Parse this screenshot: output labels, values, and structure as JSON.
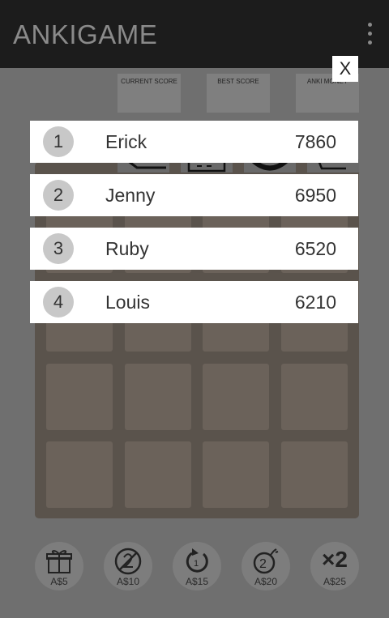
{
  "app": {
    "title": "ANKIGAME"
  },
  "scores": [
    {
      "label": "CURRENT SCORE"
    },
    {
      "label": "BEST SCORE"
    },
    {
      "label": "ANKI MONEY"
    }
  ],
  "overlay": {
    "close_label": "X"
  },
  "leaderboard": [
    {
      "rank": "1",
      "name": "Erick",
      "score": "7860"
    },
    {
      "rank": "2",
      "name": "Jenny",
      "score": "6950"
    },
    {
      "rank": "3",
      "name": "Ruby",
      "score": "6520"
    },
    {
      "rank": "4",
      "name": "Louis",
      "score": "6210"
    }
  ],
  "board": {
    "rows": 4,
    "cols": 4
  },
  "powerups": [
    {
      "icon": "gift-icon",
      "price": "A$5"
    },
    {
      "icon": "no-two-icon",
      "price": "A$10"
    },
    {
      "icon": "undo-icon",
      "price": "A$15"
    },
    {
      "icon": "bomb-icon",
      "price": "A$20"
    },
    {
      "icon": "double-icon",
      "price": "A$25",
      "glyph": "×2"
    }
  ],
  "colors": {
    "appbar": "#1c1c1c",
    "dim": "#6f6f6f",
    "board": "#5a534c",
    "tile": "#6b625a",
    "row": "#ffffff"
  }
}
